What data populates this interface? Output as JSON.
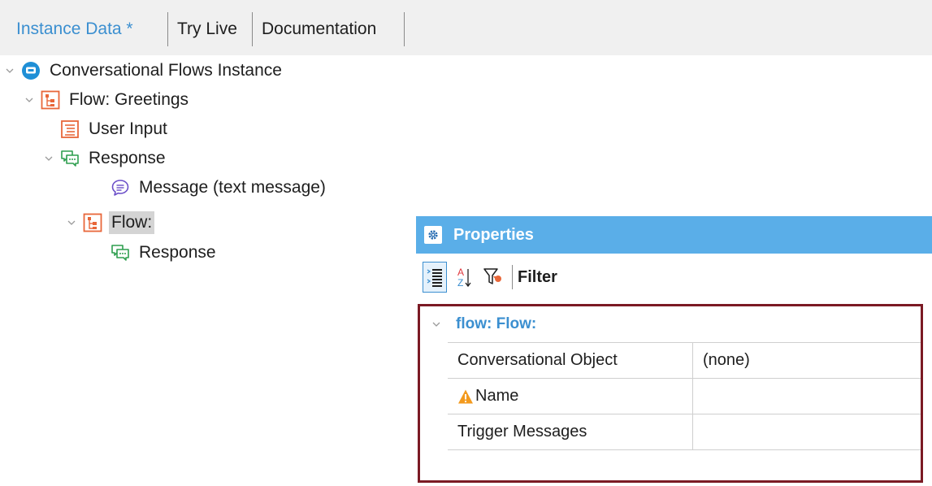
{
  "tabs": [
    {
      "label": "Instance Data *",
      "active": true
    },
    {
      "label": "Try Live",
      "active": false
    },
    {
      "label": "Documentation",
      "active": false
    }
  ],
  "tree": {
    "root": "Conversational Flows Instance",
    "flow1": "Flow: Greetings",
    "user_input": "User Input",
    "response1": "Response",
    "message": "Message (text message)",
    "flow2": "Flow:",
    "response2": "Response"
  },
  "properties": {
    "title": "Properties",
    "filter_label": "Filter",
    "category": "flow: Flow:",
    "rows": [
      {
        "name": "Conversational Object",
        "value": "(none)",
        "warning": false
      },
      {
        "name": "Name",
        "value": "",
        "warning": true
      },
      {
        "name": "Trigger Messages",
        "value": "",
        "warning": false
      }
    ]
  },
  "colors": {
    "accent": "#3b8fd0",
    "header": "#5aaee8",
    "highlight_frame": "#7b1a24",
    "flow_icon": "#e8673a",
    "response_icon": "#2e9e4f",
    "message_icon": "#6b4fc8"
  },
  "icons": {
    "root": "conversational-instance-icon",
    "flow": "flow-icon",
    "user_input": "user-input-icon",
    "response": "response-icon",
    "message": "message-icon"
  }
}
